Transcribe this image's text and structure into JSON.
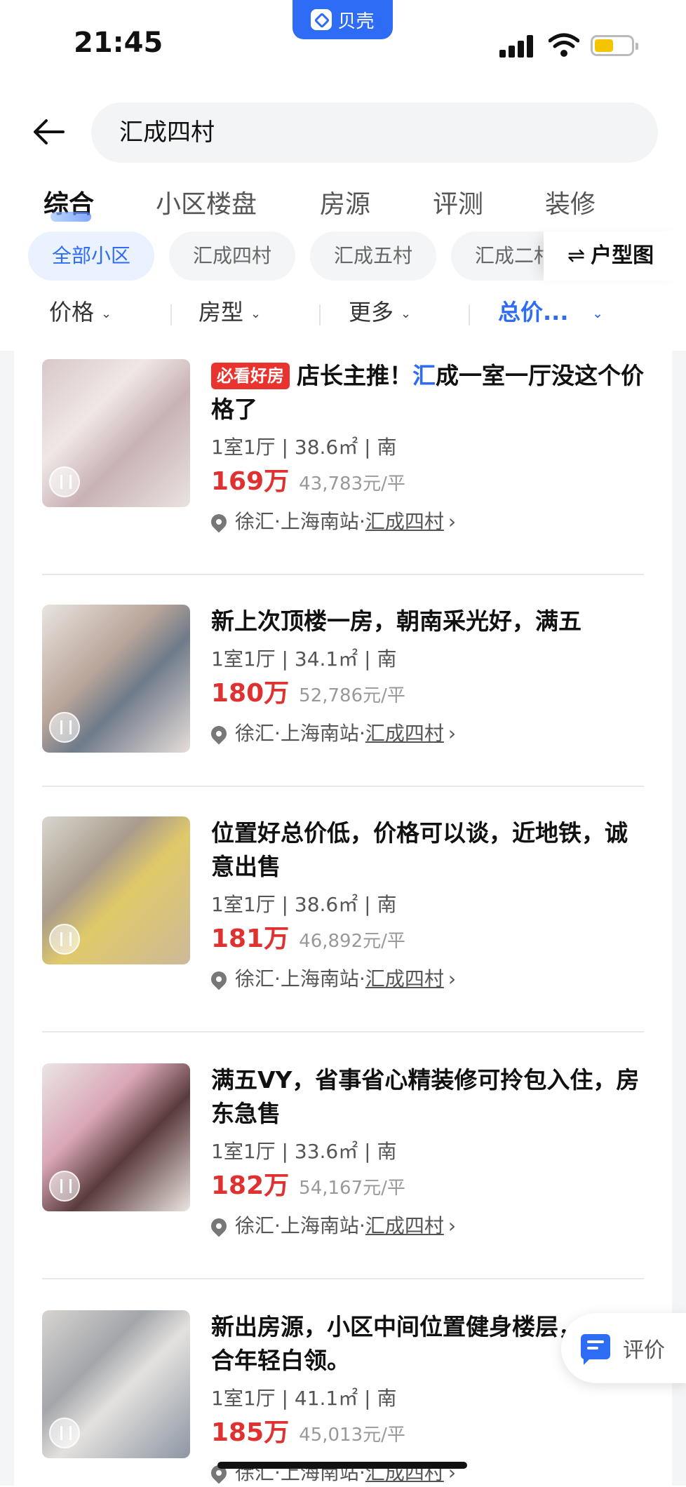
{
  "status_bar": {
    "time": "21:45",
    "app_badge": "贝壳"
  },
  "search": {
    "query": "汇成四村"
  },
  "tabs": [
    {
      "label": "综合",
      "active": true
    },
    {
      "label": "小区楼盘",
      "active": false
    },
    {
      "label": "房源",
      "active": false
    },
    {
      "label": "评测",
      "active": false
    },
    {
      "label": "装修",
      "active": false
    }
  ],
  "chips": [
    {
      "label": "全部小区",
      "active": true
    },
    {
      "label": "汇成四村",
      "active": false
    },
    {
      "label": "汇成五村",
      "active": false
    },
    {
      "label": "汇成二村",
      "active": false
    }
  ],
  "huxing_label": "户型图",
  "filters": [
    {
      "label": "价格",
      "active": false
    },
    {
      "label": "房型",
      "active": false
    },
    {
      "label": "更多",
      "active": false
    },
    {
      "label": "总价...",
      "active": true
    }
  ],
  "listings": [
    {
      "tag": "必看好房",
      "title_pre": "店长主推！",
      "title_hl": "汇",
      "title_post": "成一室一厅没这个价格了",
      "layout": "1室1厅",
      "area": "38.6㎡",
      "facing": "南",
      "price": "169万",
      "unit_price": "43,783元/平",
      "district": "徐汇",
      "area_name": "上海南站",
      "community": "汇成四村"
    },
    {
      "tag": "",
      "title_pre": "新上次顶楼一房，朝南采光好，满五",
      "title_hl": "",
      "title_post": "",
      "layout": "1室1厅",
      "area": "34.1㎡",
      "facing": "南",
      "price": "180万",
      "unit_price": "52,786元/平",
      "district": "徐汇",
      "area_name": "上海南站",
      "community": "汇成四村"
    },
    {
      "tag": "",
      "title_pre": "位置好总价低，价格可以谈，近地铁，诚意出售",
      "title_hl": "",
      "title_post": "",
      "layout": "1室1厅",
      "area": "38.6㎡",
      "facing": "南",
      "price": "181万",
      "unit_price": "46,892元/平",
      "district": "徐汇",
      "area_name": "上海南站",
      "community": "汇成四村"
    },
    {
      "tag": "",
      "title_pre": "满五VY，省事省心精装修可拎包入住，房东急售",
      "title_hl": "",
      "title_post": "",
      "layout": "1室1厅",
      "area": "33.6㎡",
      "facing": "南",
      "price": "182万",
      "unit_price": "54,167元/平",
      "district": "徐汇",
      "area_name": "上海南站",
      "community": "汇成四村"
    },
    {
      "tag": "",
      "title_pre": "新出房源，小区中间位置健身楼层，合年轻白领。",
      "title_hl": "",
      "title_post": "",
      "layout": "1室1厅",
      "area": "41.1㎡",
      "facing": "南",
      "price": "185万",
      "unit_price": "45,013元/平",
      "district": "徐汇",
      "area_name": "上海南站",
      "community": "汇成四村"
    }
  ],
  "review_button": {
    "label": "评价"
  },
  "colors": {
    "accent": "#2f6cf5",
    "price": "#e03131",
    "tag": "#e8332e"
  }
}
